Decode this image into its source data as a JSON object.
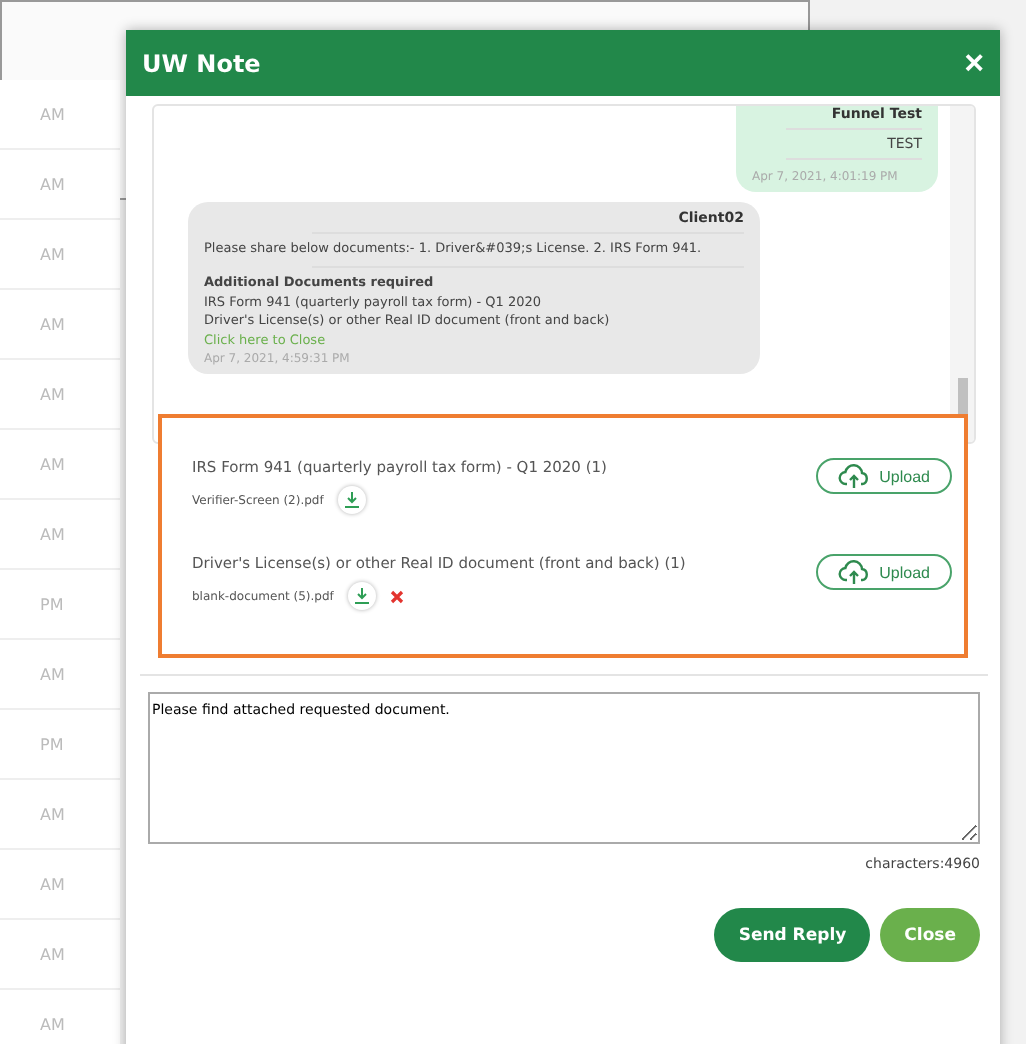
{
  "background": {
    "times": [
      "AM",
      "AM",
      "AM",
      "AM",
      "AM",
      "AM",
      "AM",
      "PM",
      "AM",
      "PM",
      "AM",
      "AM",
      "AM",
      "AM"
    ]
  },
  "modal": {
    "title": "UW Note",
    "close_icon": "×"
  },
  "messages": [
    {
      "kind": "sent",
      "sender": "Funnel Test",
      "lines": [
        "TEST"
      ],
      "time": "Apr 7, 2021, 4:01:19 PM"
    },
    {
      "kind": "received",
      "sender": "Client02",
      "text": "Please share below documents:- 1. Driver&#039;s License. 2. IRS Form 941.",
      "heading": "Additional Documents required",
      "lines": [
        "IRS Form 941 (quarterly payroll tax form) - Q1 2020",
        "Driver's License(s) or other Real ID document (front and back)"
      ],
      "link": "Click here to Close",
      "time": "Apr 7, 2021, 4:59:31 PM"
    }
  ],
  "documents": [
    {
      "title": "IRS Form 941 (quarterly payroll tax form) - Q1 2020 (1)",
      "file": "Verifier-Screen (2).pdf",
      "removable": false,
      "upload": "Upload"
    },
    {
      "title": "Driver's License(s) or other Real ID document (front and back) (1)",
      "file": "blank-document (5).pdf",
      "removable": true,
      "upload": "Upload"
    }
  ],
  "reply": {
    "value": "Please find attached requested document.",
    "counter": "characters:4960"
  },
  "buttons": [
    {
      "label": "Send Reply",
      "kind": "primary"
    },
    {
      "label": "Close",
      "kind": "secondary"
    }
  ]
}
